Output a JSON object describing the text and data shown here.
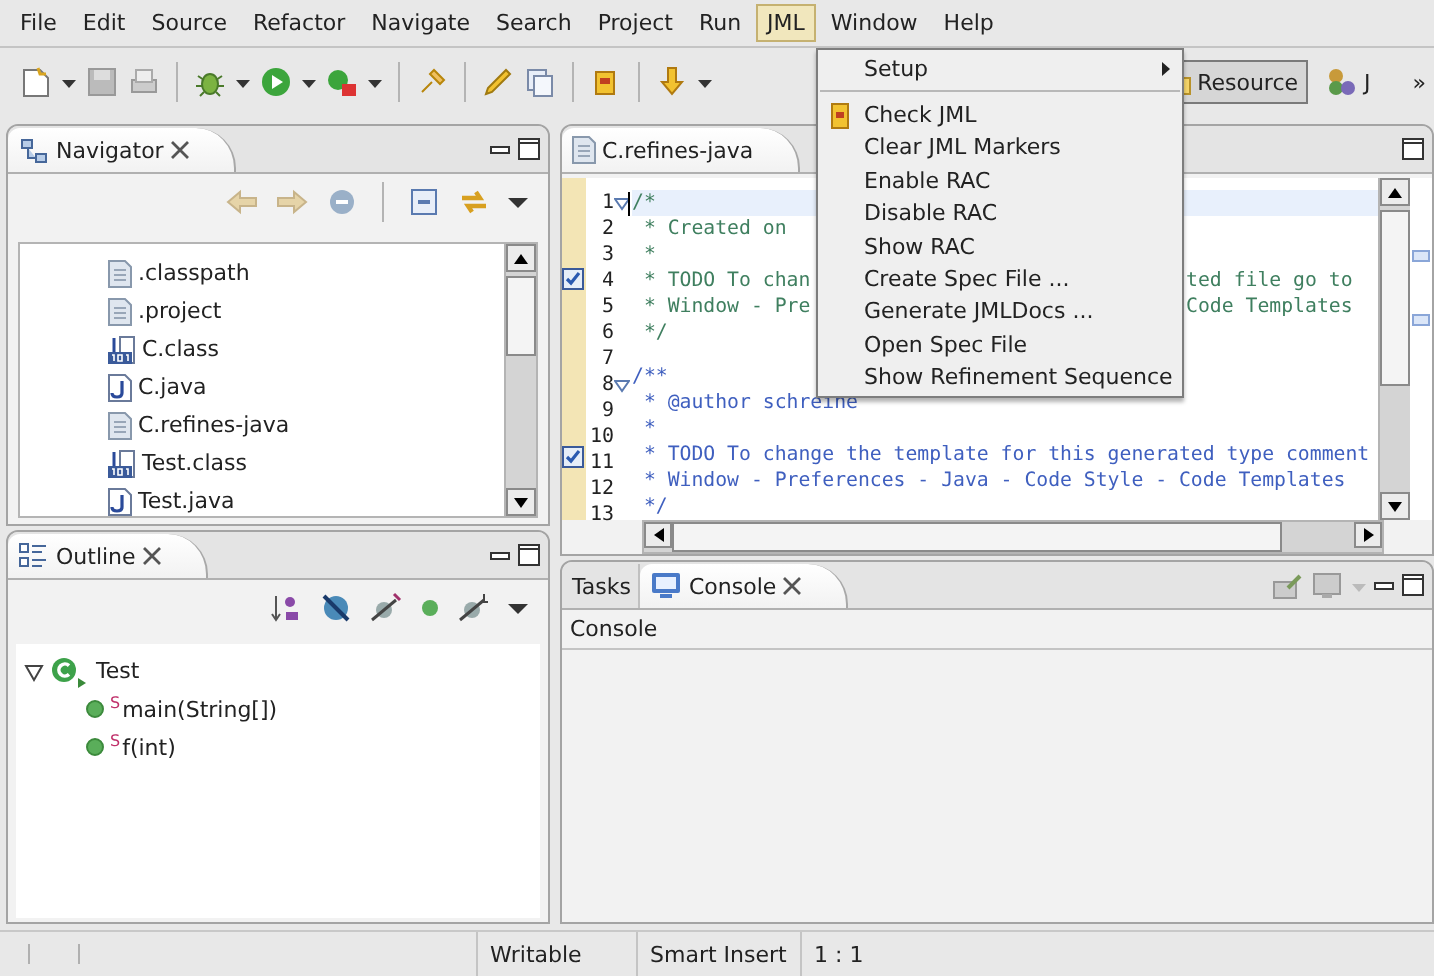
{
  "menubar": [
    {
      "label": "File",
      "selected": false
    },
    {
      "label": "Edit",
      "selected": false
    },
    {
      "label": "Source",
      "selected": false
    },
    {
      "label": "Refactor",
      "selected": false
    },
    {
      "label": "Navigate",
      "selected": false
    },
    {
      "label": "Search",
      "selected": false
    },
    {
      "label": "Project",
      "selected": false
    },
    {
      "label": "Run",
      "selected": false
    },
    {
      "label": "JML",
      "selected": true
    },
    {
      "label": "Window",
      "selected": false
    },
    {
      "label": "Help",
      "selected": false
    }
  ],
  "jml_menu": [
    {
      "kind": "submenu",
      "label": "Setup"
    },
    {
      "kind": "separator"
    },
    {
      "kind": "icon",
      "label": "Check JML"
    },
    {
      "kind": "plain",
      "label": "Clear JML Markers"
    },
    {
      "kind": "plain",
      "label": "Enable RAC"
    },
    {
      "kind": "plain",
      "label": "Disable RAC"
    },
    {
      "kind": "plain",
      "label": "Show RAC"
    },
    {
      "kind": "plain",
      "label": "Create Spec File ..."
    },
    {
      "kind": "plain",
      "label": "Generate JMLDocs ..."
    },
    {
      "kind": "plain",
      "label": "Open Spec File"
    },
    {
      "kind": "plain",
      "label": "Show Refinement Sequence"
    }
  ],
  "toolbar": {
    "perspectives": [
      {
        "label": "Resource",
        "selected": true
      },
      {
        "label": "J",
        "selected": false
      }
    ],
    "more": "»"
  },
  "navigator": {
    "tab": {
      "label": "Navigator",
      "selected": true
    },
    "items": [
      {
        "kind": "text",
        "label": ".classpath"
      },
      {
        "kind": "text",
        "label": ".project"
      },
      {
        "kind": "class",
        "label": "C.class"
      },
      {
        "kind": "java",
        "label": "C.java"
      },
      {
        "kind": "text",
        "label": "C.refines-java"
      },
      {
        "kind": "class",
        "label": "Test.class"
      },
      {
        "kind": "java",
        "label": "Test.java"
      }
    ]
  },
  "outline": {
    "tab": {
      "label": "Outline",
      "selected": true
    },
    "tree": [
      {
        "kind": "class",
        "label": "Test",
        "expanded": true,
        "children": [
          {
            "kind": "method",
            "label": "$^{S}$main(String[])"
          },
          {
            "kind": "method",
            "label": "$^{S}$f(int)"
          }
        ]
      }
    ]
  },
  "editor": {
    "tabs": [
      {
        "label": "C.refines-java",
        "selected": true
      }
    ],
    "lines": [
      {
        "number": "1",
        "text": "/*",
        "kind": "comment",
        "fold": true,
        "task": false,
        "current": true
      },
      {
        "number": "2",
        "text": " * Created on",
        "kind": "comment",
        "fold": false,
        "task": false,
        "current": false
      },
      {
        "number": "3",
        "text": " *",
        "kind": "comment",
        "fold": false,
        "task": false,
        "current": false
      },
      {
        "number": "4",
        "text": " * TODO To chan",
        "tail": "ted file go to",
        "kind": "comment",
        "fold": false,
        "task": true,
        "current": false
      },
      {
        "number": "5",
        "text": " * Window - Pre",
        "tail": "Code Templates",
        "kind": "comment",
        "fold": false,
        "task": false,
        "current": false
      },
      {
        "number": "6",
        "text": " */",
        "kind": "comment",
        "fold": false,
        "task": false,
        "current": false
      },
      {
        "number": "7",
        "fold": false,
        "task": false,
        "current": false
      },
      {
        "number": "8",
        "text": "/**",
        "kind": "javadoc",
        "fold": true,
        "task": false,
        "current": false
      },
      {
        "number": "9",
        "text": " * @author schreine",
        "kind": "javadoc",
        "fold": false,
        "task": false,
        "current": false
      },
      {
        "number": "10",
        "text": " *",
        "kind": "javadoc",
        "fold": false,
        "task": false,
        "current": false
      },
      {
        "number": "11",
        "text": " * TODO To change the template for this generated type comment",
        "kind": "javadoc",
        "fold": false,
        "task": true,
        "current": false
      },
      {
        "number": "12",
        "text": " * Window - Preferences - Java - Code Style - Code Templates",
        "kind": "javadoc",
        "fold": false,
        "task": false,
        "current": false
      },
      {
        "number": "13",
        "text": " */",
        "kind": "javadoc",
        "fold": false,
        "task": false,
        "current": false
      }
    ]
  },
  "console": {
    "tabs": [
      {
        "kind": "tasks",
        "label": "Tasks",
        "selected": false
      },
      {
        "kind": "console",
        "label": "Console",
        "selected": true
      }
    ],
    "heading": "Console"
  },
  "status_bar": [
    "Writable",
    "Smart Insert",
    "1 : 1"
  ]
}
